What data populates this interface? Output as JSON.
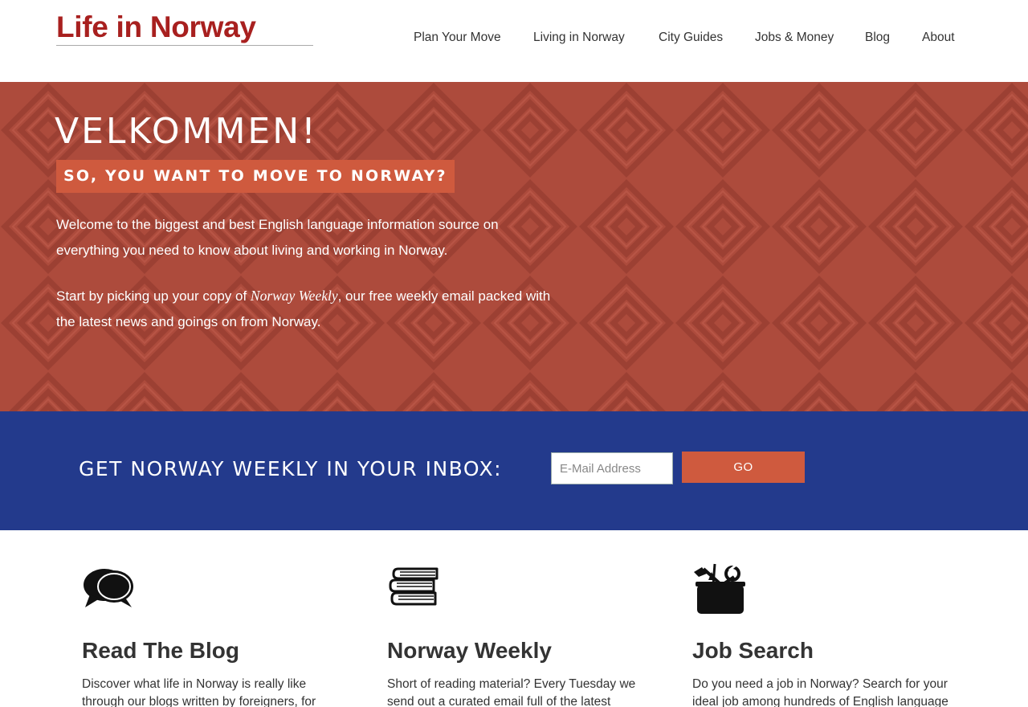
{
  "site": {
    "logo": "Life in Norway"
  },
  "nav": {
    "items": [
      {
        "label": "Plan Your Move"
      },
      {
        "label": "Living in Norway"
      },
      {
        "label": "City Guides"
      },
      {
        "label": "Jobs & Money"
      },
      {
        "label": "Blog"
      },
      {
        "label": "About"
      }
    ]
  },
  "hero": {
    "title": "VELKOMMEN!",
    "tagline": "SO, YOU WANT TO MOVE TO NORWAY?",
    "paragraph1": "Welcome to the biggest and best English language information source on everything you need to know about living and working in Norway.",
    "paragraph2_start": "Start by picking up your copy of ",
    "paragraph2_em": "Norway Weekly",
    "paragraph2_end": ", our free weekly email packed with the latest news and goings on from Norway."
  },
  "subscribe": {
    "title": "GET NORWAY WEEKLY IN YOUR INBOX:",
    "placeholder": "E-Mail Address",
    "button": "GO"
  },
  "features": [
    {
      "icon": "speech-bubbles-icon",
      "title": "Read The Blog",
      "text": "Discover what life in Norway is really like through our blogs written by foreigners, for"
    },
    {
      "icon": "books-icon",
      "title": "Norway Weekly",
      "text": "Short of reading material? Every Tuesday we send out a curated email full of the latest"
    },
    {
      "icon": "toolbox-icon",
      "title": "Job Search",
      "text": "Do you need a job in Norway? Search for your ideal job among hundreds of English language"
    }
  ],
  "colors": {
    "brand_red": "#a8201f",
    "hero_bg": "#ad4b3c",
    "accent_orange": "#cf5a3e",
    "band_blue": "#233a8c"
  }
}
